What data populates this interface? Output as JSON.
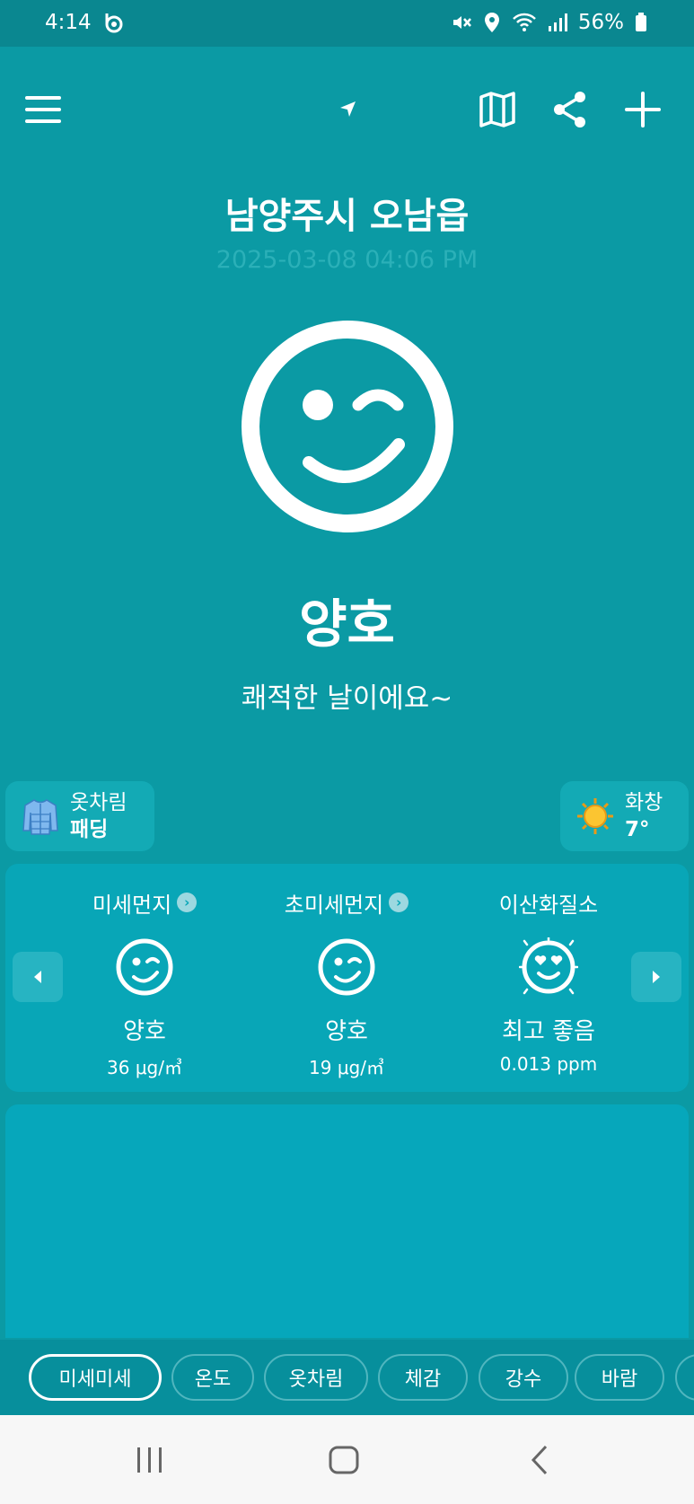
{
  "status_bar": {
    "time": "4:14",
    "battery": "56%"
  },
  "header": {
    "icons": [
      "menu-icon",
      "location-arrow-icon",
      "map-icon",
      "share-icon",
      "plus-icon"
    ]
  },
  "location": {
    "name": "남양주시 오남읍",
    "timestamp": "2025-03-08 04:06 PM"
  },
  "overall": {
    "face_icon": "winking-face-icon",
    "status": "양호",
    "message": "쾌적한 날이에요~"
  },
  "chips": {
    "clothing": {
      "label": "옷차림",
      "value": "패딩",
      "icon": "padded-jacket-icon"
    },
    "weather": {
      "label": "화창",
      "value": "7°",
      "icon": "sun-icon"
    }
  },
  "air_quality": {
    "metrics": [
      {
        "title": "미세먼지",
        "status": "양호",
        "value": "36 μg/㎥",
        "face_icon": "winking-face-icon"
      },
      {
        "title": "초미세먼지",
        "status": "양호",
        "value": "19 μg/㎥",
        "face_icon": "winking-face-icon"
      },
      {
        "title": "이산화질소",
        "status": "최고 좋음",
        "value": "0.013 ppm",
        "face_icon": "heart-eyes-face-icon"
      }
    ]
  },
  "tabs": [
    {
      "label": "미세미세",
      "active": true
    },
    {
      "label": "온도",
      "active": false
    },
    {
      "label": "옷차림",
      "active": false
    },
    {
      "label": "체감",
      "active": false
    },
    {
      "label": "강수",
      "active": false
    },
    {
      "label": "바람",
      "active": false
    }
  ],
  "colors": {
    "background": "#0b9aa4",
    "card": "#08a6b7",
    "status_bar": "#0a8790",
    "tab_bar": "#078f9c"
  }
}
